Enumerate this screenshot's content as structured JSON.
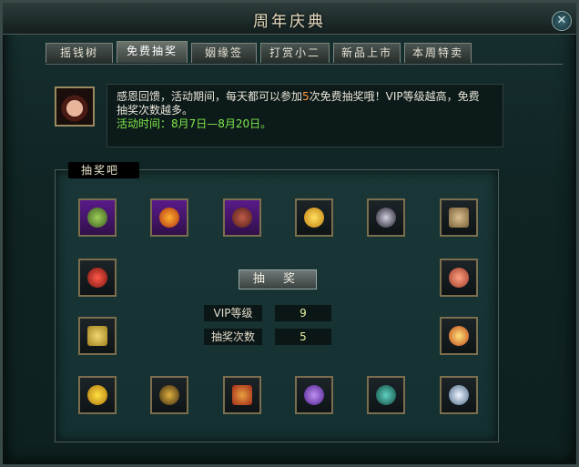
{
  "window": {
    "title": "周年庆典",
    "close_icon": "close-icon"
  },
  "tabs": [
    {
      "label": "摇钱树",
      "active": false
    },
    {
      "label": "免费抽奖",
      "active": true
    },
    {
      "label": "姻缘签",
      "active": false
    },
    {
      "label": "打赏小二",
      "active": false
    },
    {
      "label": "新品上市",
      "active": false
    },
    {
      "label": "本周特卖",
      "active": false
    }
  ],
  "info": {
    "line1_pre": "感恩回馈，活动期间，每天都可以参加",
    "line1_num": "5",
    "line1_post": "次免费抽奖哦！VIP等级越高，免费",
    "line2": "抽奖次数越多。",
    "time": "活动时间：8月7日—8月20日。"
  },
  "lottery": {
    "section_label": "抽奖吧",
    "draw_button": "抽  奖",
    "vip_label": "VIP等级",
    "vip_value": "9",
    "count_label": "抽奖次数",
    "count_value": "5"
  },
  "items": [
    "green-gem-icon",
    "flame-wing-icon",
    "horn-icon",
    "golden-leaf-icon",
    "dark-orb-icon",
    "scroll-icon",
    "red-lantern-icon",
    "peach-icon",
    "golden-scroll-icon",
    "golden-peach-icon",
    "gold-ingot-icon",
    "star-flower-icon",
    "bamboo-scroll-icon",
    "purple-crystal-icon",
    "jade-mound-icon",
    "silver-orb-icon"
  ],
  "colors": {
    "accent_orange": "#ff9a3a",
    "accent_green": "#7ee84a",
    "frame_gold": "#7a6e4e"
  }
}
